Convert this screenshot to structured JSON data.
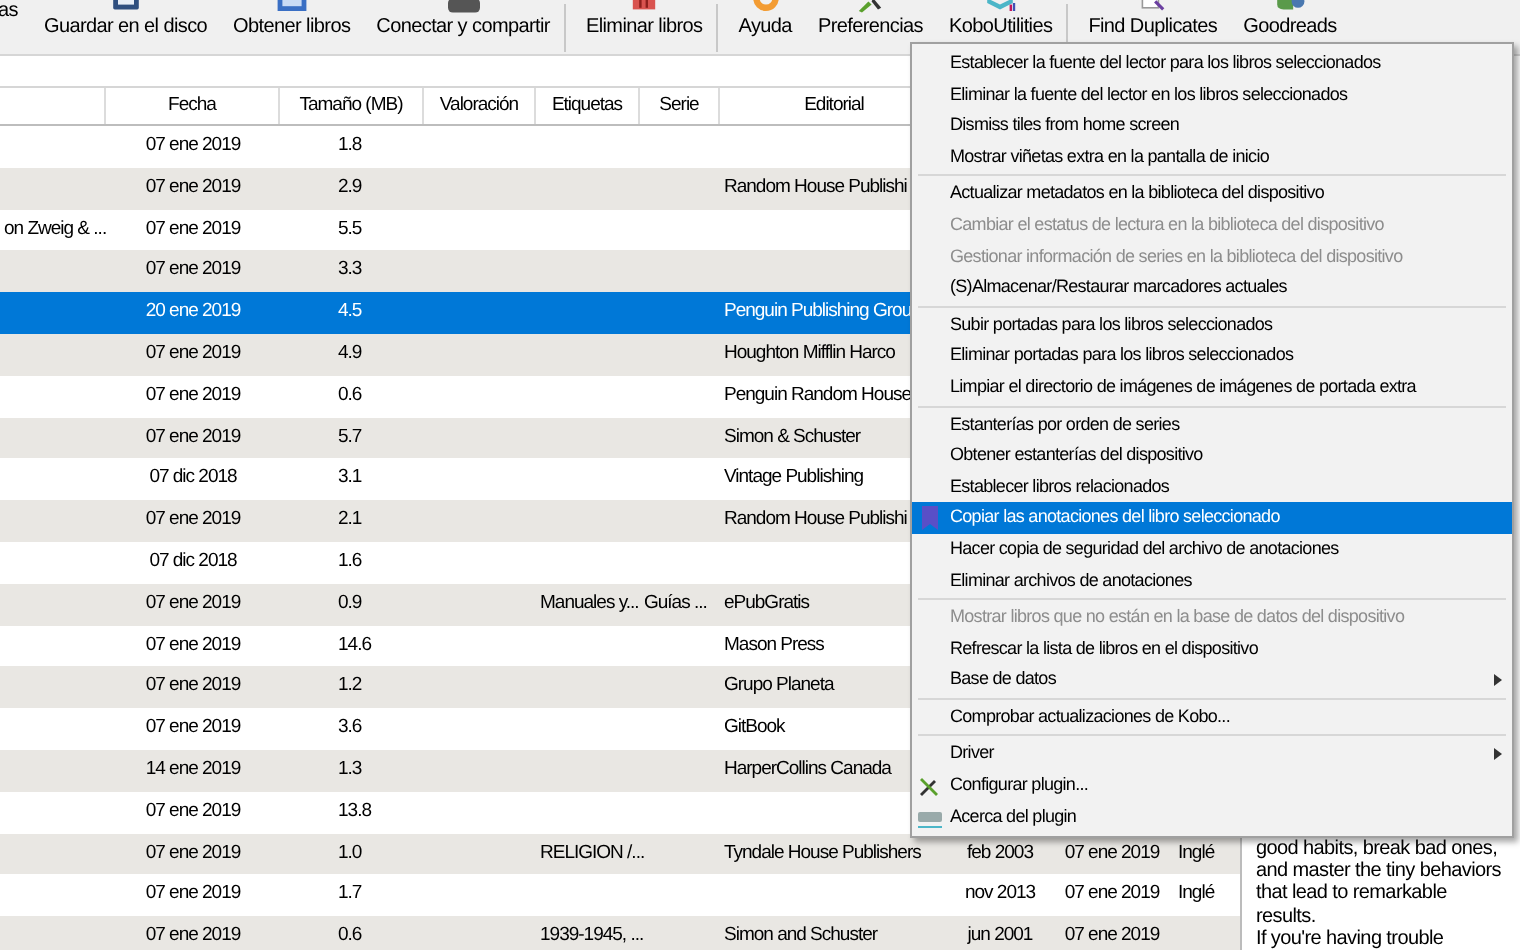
{
  "toolbar": [
    {
      "label": "as"
    },
    {
      "label": "Guardar en el disco"
    },
    {
      "label": "Obtener libros"
    },
    {
      "label": "Conectar y compartir",
      "separator_after": true
    },
    {
      "label": "Eliminar libros",
      "separator_after": true
    },
    {
      "label": "Ayuda"
    },
    {
      "label": "Preferencias"
    },
    {
      "label": "KoboUtilities",
      "separator_after": true
    },
    {
      "label": "Find Duplicates"
    },
    {
      "label": "Goodreads"
    }
  ],
  "table": {
    "columns": [
      "",
      "Fecha",
      "Tamaño (MB)",
      "Valoración",
      "Etiquetas",
      "Serie",
      "Editorial"
    ],
    "rows": [
      {
        "selected": false,
        "author": "",
        "date": "07 ene 2019",
        "size": "1.8",
        "tags": "",
        "series": "",
        "publisher": ""
      },
      {
        "selected": false,
        "author": "",
        "date": "07 ene 2019",
        "size": "2.9",
        "tags": "",
        "series": "",
        "publisher": "Random House Publishi"
      },
      {
        "selected": false,
        "author": "on Zweig & ...",
        "date": "07 ene 2019",
        "size": "5.5",
        "tags": "",
        "series": "",
        "publisher": ""
      },
      {
        "selected": false,
        "author": "",
        "date": "07 ene 2019",
        "size": "3.3",
        "tags": "",
        "series": "",
        "publisher": ""
      },
      {
        "selected": true,
        "author": "",
        "date": "20 ene 2019",
        "size": "4.5",
        "tags": "",
        "series": "",
        "publisher": "Penguin Publishing Grou"
      },
      {
        "selected": false,
        "author": "",
        "date": "07 ene 2019",
        "size": "4.9",
        "tags": "",
        "series": "",
        "publisher": "Houghton Mifflin Harco"
      },
      {
        "selected": false,
        "author": "",
        "date": "07 ene 2019",
        "size": "0.6",
        "tags": "",
        "series": "",
        "publisher": "Penguin Random House"
      },
      {
        "selected": false,
        "author": "",
        "date": "07 ene 2019",
        "size": "5.7",
        "tags": "",
        "series": "",
        "publisher": "Simon & Schuster"
      },
      {
        "selected": false,
        "author": "",
        "date": "07 dic 2018",
        "size": "3.1",
        "tags": "",
        "series": "",
        "publisher": "Vintage Publishing"
      },
      {
        "selected": false,
        "author": "",
        "date": "07 ene 2019",
        "size": "2.1",
        "tags": "",
        "series": "",
        "publisher": "Random House Publishi"
      },
      {
        "selected": false,
        "author": "",
        "date": "07 dic 2018",
        "size": "1.6",
        "tags": "",
        "series": "",
        "publisher": ""
      },
      {
        "selected": false,
        "author": "",
        "date": "07 ene 2019",
        "size": "0.9",
        "tags": "Manuales y...",
        "series": "Guías ...",
        "publisher": "ePubGratis"
      },
      {
        "selected": false,
        "author": "",
        "date": "07 ene 2019",
        "size": "14.6",
        "tags": "",
        "series": "",
        "publisher": "Mason Press"
      },
      {
        "selected": false,
        "author": "",
        "date": "07 ene 2019",
        "size": "1.2",
        "tags": "",
        "series": "",
        "publisher": "Grupo Planeta"
      },
      {
        "selected": false,
        "author": "",
        "date": "07 ene 2019",
        "size": "3.6",
        "tags": "",
        "series": "",
        "publisher": "GitBook"
      },
      {
        "selected": false,
        "author": "",
        "date": "14 ene 2019",
        "size": "1.3",
        "tags": "",
        "series": "",
        "publisher": "HarperCollins Canada"
      },
      {
        "selected": false,
        "author": "",
        "date": "07 ene 2019",
        "size": "13.8",
        "tags": "",
        "series": "",
        "publisher": ""
      },
      {
        "selected": false,
        "author": "",
        "date": "07 ene 2019",
        "size": "1.0",
        "tags": "RELIGION /...",
        "series": "",
        "publisher": "Tyndale House Publishers",
        "published": "feb 2003",
        "modified": "07 ene 2019",
        "language": "Inglé"
      },
      {
        "selected": false,
        "author": "",
        "date": "07 ene 2019",
        "size": "1.7",
        "tags": "",
        "series": "",
        "publisher": "",
        "published": "nov 2013",
        "modified": "07 ene 2019",
        "language": "Inglé"
      },
      {
        "selected": false,
        "author": "",
        "date": "07 ene 2019",
        "size": "0.6",
        "tags": "1939-1945, ...",
        "series": "",
        "publisher": "Simon and Schuster",
        "published": "jun 2001",
        "modified": "07 ene 2019"
      }
    ]
  },
  "details": [
    "good habits, break bad ones,",
    "and master the tiny behaviors",
    "that lead to remarkable",
    "results.",
    "If you're having trouble"
  ],
  "menu": [
    {
      "kind": "item",
      "label": "Establecer la fuente del lector para los libros seleccionados",
      "disabled": false,
      "selected": false
    },
    {
      "kind": "item",
      "label": "Eliminar la fuente del lector en los libros seleccionados",
      "disabled": false,
      "selected": false
    },
    {
      "kind": "item",
      "label": "Dismiss tiles from home screen",
      "disabled": false,
      "selected": false
    },
    {
      "kind": "item",
      "label": "Mostrar viñetas extra en la pantalla de inicio",
      "disabled": false,
      "selected": false
    },
    {
      "kind": "separator"
    },
    {
      "kind": "item",
      "label": "Actualizar metadatos en la biblioteca del dispositivo",
      "disabled": false,
      "selected": false
    },
    {
      "kind": "item",
      "label": "Cambiar el estatus de lectura en la biblioteca del dispositivo",
      "disabled": true,
      "selected": false
    },
    {
      "kind": "item",
      "label": "Gestionar información de series en la biblioteca del dispositivo",
      "disabled": true,
      "selected": false
    },
    {
      "kind": "item",
      "label": "(S)Almacenar/Restaurar marcadores actuales",
      "disabled": false,
      "selected": false
    },
    {
      "kind": "separator"
    },
    {
      "kind": "item",
      "label": "Subir portadas para los libros seleccionados",
      "disabled": false,
      "selected": false
    },
    {
      "kind": "item",
      "label": "Eliminar portadas para los libros seleccionados",
      "disabled": false,
      "selected": false
    },
    {
      "kind": "item",
      "label": "Limpiar el directorio de imágenes de imágenes de portada extra",
      "disabled": false,
      "selected": false
    },
    {
      "kind": "separator"
    },
    {
      "kind": "item",
      "label": "Estanterías por orden de series",
      "disabled": false,
      "selected": false
    },
    {
      "kind": "item",
      "label": "Obtener estanterías del dispositivo",
      "disabled": false,
      "selected": false
    },
    {
      "kind": "item",
      "label": "Establecer libros relacionados",
      "disabled": false,
      "selected": false
    },
    {
      "kind": "item",
      "label": "Copiar las anotaciones del libro seleccionado",
      "disabled": false,
      "selected": true
    },
    {
      "kind": "item",
      "label": "Hacer copia de seguridad del archivo de anotaciones",
      "disabled": false,
      "selected": false
    },
    {
      "kind": "item",
      "label": "Eliminar archivos de anotaciones",
      "disabled": false,
      "selected": false
    },
    {
      "kind": "separator"
    },
    {
      "kind": "item",
      "label": "Mostrar libros que no están en la base de datos del dispositivo",
      "disabled": true,
      "selected": false
    },
    {
      "kind": "item",
      "label": "Refrescar la lista de libros en el dispositivo",
      "disabled": false,
      "selected": false
    },
    {
      "kind": "item",
      "label": "Base de datos",
      "disabled": false,
      "selected": false,
      "submenu": true
    },
    {
      "kind": "separator"
    },
    {
      "kind": "item",
      "label": "Comprobar actualizaciones de Kobo...",
      "disabled": false,
      "selected": false
    },
    {
      "kind": "separator"
    },
    {
      "kind": "item",
      "label": "Driver",
      "disabled": false,
      "selected": false,
      "submenu": true
    },
    {
      "kind": "item",
      "label": "Configurar plugin...",
      "disabled": false,
      "selected": false
    },
    {
      "kind": "item",
      "label": "Acerca del plugin",
      "disabled": false,
      "selected": false
    }
  ]
}
